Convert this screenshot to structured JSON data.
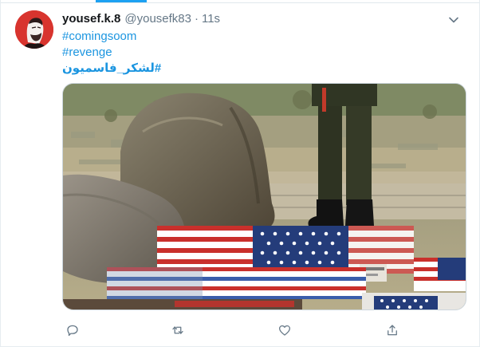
{
  "tweet": {
    "display_name": "yousef.k.8",
    "handle": "@yousefk83",
    "separator": "·",
    "time": "11s",
    "hashtags": [
      "#comingsoom",
      "#revenge",
      "#لشكر_فاسميون"
    ]
  },
  "icons": {
    "more": "chevron-down-icon",
    "reply": "reply-icon",
    "retweet": "retweet-icon",
    "like": "heart-icon",
    "share": "share-icon"
  },
  "colors": {
    "link": "#1b95e0",
    "name": "#14171a",
    "muted": "#657786",
    "avatar_bg": "#d8342e",
    "accent": "#1da1f2"
  }
}
